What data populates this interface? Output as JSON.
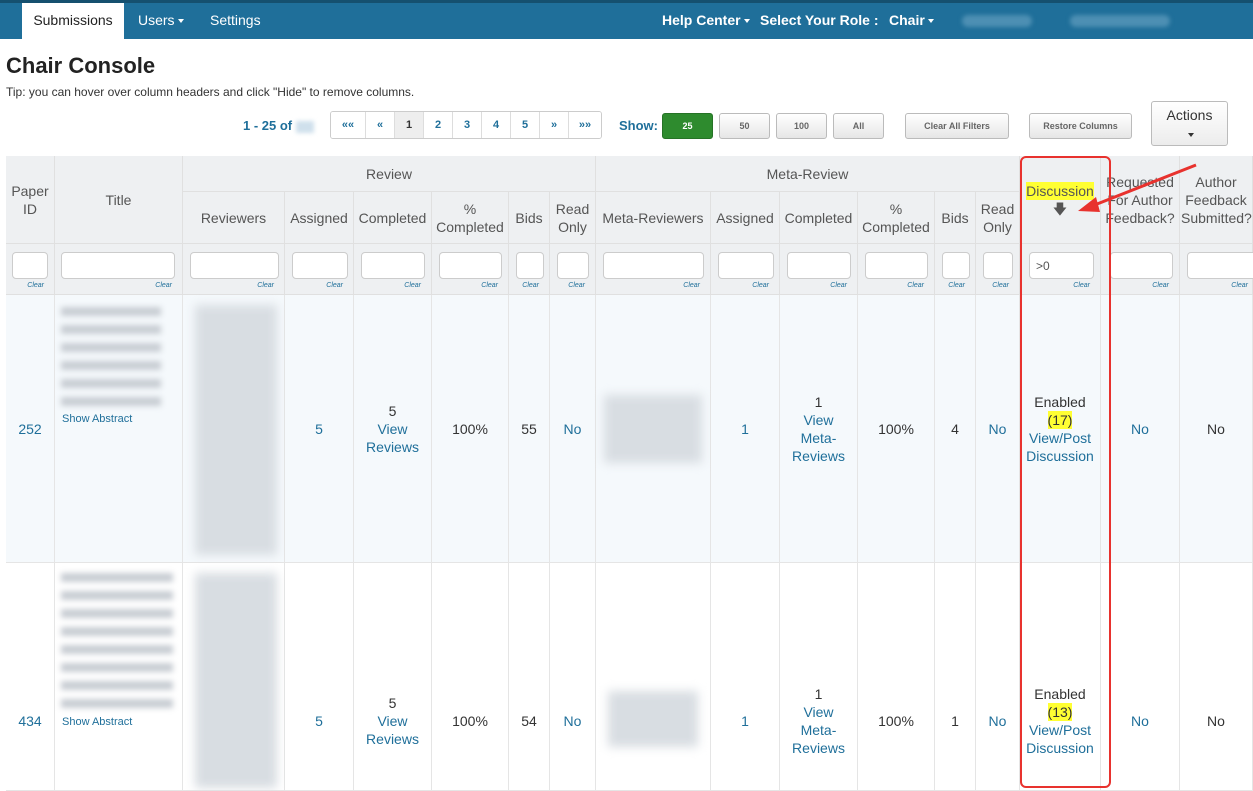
{
  "nav": {
    "tabs": [
      {
        "label": "Submissions"
      },
      {
        "label": "Users"
      },
      {
        "label": "Settings"
      }
    ],
    "help_center": "Help Center",
    "select_role_label": "Select Your Role :",
    "role": "Chair"
  },
  "page": {
    "title": "Chair Console",
    "tip": "Tip: you can hover over column headers and click \"Hide\" to remove columns."
  },
  "toolbar": {
    "range": "1 - 25 of",
    "pages": [
      "««",
      "«",
      "1",
      "2",
      "3",
      "4",
      "5",
      "»",
      "»»"
    ],
    "current_page": "1",
    "show_label": "Show:",
    "show_options": [
      "25",
      "50",
      "100",
      "All"
    ],
    "show_selected": "25",
    "clear_filters": "Clear All Filters",
    "restore_columns": "Restore Columns",
    "actions": "Actions"
  },
  "table": {
    "group_review": "Review",
    "group_meta": "Meta-Review",
    "headers": {
      "paper_id": "Paper ID",
      "title": "Title",
      "reviewers": "Reviewers",
      "assigned": "Assigned",
      "completed": "Completed",
      "pct_completed": "% Completed",
      "bids": "Bids",
      "read_only": "Read Only",
      "meta_reviewers": "Meta-Reviewers",
      "discussion": "Discussion",
      "requested_feedback": "Requested For Author Feedback?",
      "author_feedback": "Author Feedback Submitted?"
    },
    "clear_label": "Clear",
    "discussion_filter": ">0",
    "rows": [
      {
        "paper_id": "252",
        "show_abstract": "Show Abstract",
        "assigned": "5",
        "completed_count": "5",
        "view_reviews": "View Reviews",
        "pct": "100%",
        "bids": "55",
        "read_only": "No",
        "meta_assigned": "1",
        "meta_completed_count": "1",
        "view_meta": "View Meta-Reviews",
        "meta_pct": "100%",
        "meta_bids": "4",
        "meta_read_only": "No",
        "discussion_status": "Enabled",
        "discussion_count": "(17)",
        "discussion_link": "View/Post Discussion",
        "requested_feedback": "No",
        "author_feedback": "No"
      },
      {
        "paper_id": "434",
        "show_abstract": "Show Abstract",
        "assigned": "5",
        "completed_count": "5",
        "view_reviews": "View Reviews",
        "pct": "100%",
        "bids": "54",
        "read_only": "No",
        "meta_assigned": "1",
        "meta_completed_count": "1",
        "view_meta": "View Meta-Reviews",
        "meta_pct": "100%",
        "meta_bids": "1",
        "meta_read_only": "No",
        "discussion_status": "Enabled",
        "discussion_count": "(13)",
        "discussion_link": "View/Post Discussion",
        "requested_feedback": "No",
        "author_feedback": "No"
      }
    ]
  },
  "colors": {
    "nav_bg": "#1f6f9a",
    "link": "#1f6f9a",
    "highlight": "#ffff33",
    "annotation": "#e8322e",
    "show_selected_bg": "#2e8b2e"
  }
}
